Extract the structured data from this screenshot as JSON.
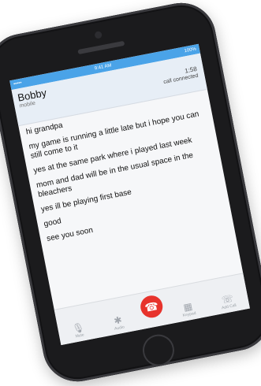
{
  "status_bar": {
    "left": "••••• ",
    "time": "9:41 AM",
    "battery": "100%"
  },
  "call": {
    "name": "Bobby",
    "subtitle": "mobile",
    "duration": "1:58",
    "state": "call connected"
  },
  "transcript": [
    "hi grandpa",
    "my game is running a little late but i hope you can still come to it",
    "yes at the same park where i played last week",
    "mom and dad will be in the usual space in the bleachers",
    "yes ill be playing first base",
    "good",
    "see you soon"
  ],
  "toolbar": {
    "mute_label": "Mute",
    "audio_label": "Audio",
    "keypad_label": "Keypad",
    "add_call_label": "Add Call"
  },
  "icons": {
    "mute": "microphone-icon",
    "audio": "bluetooth-icon",
    "end": "phone-end-icon",
    "keypad": "keypad-icon",
    "add_call": "add-call-icon"
  },
  "colors": {
    "status_bar": "#4aa3e8",
    "end_call": "#e7332c",
    "header_bg": "#e7eef6"
  }
}
